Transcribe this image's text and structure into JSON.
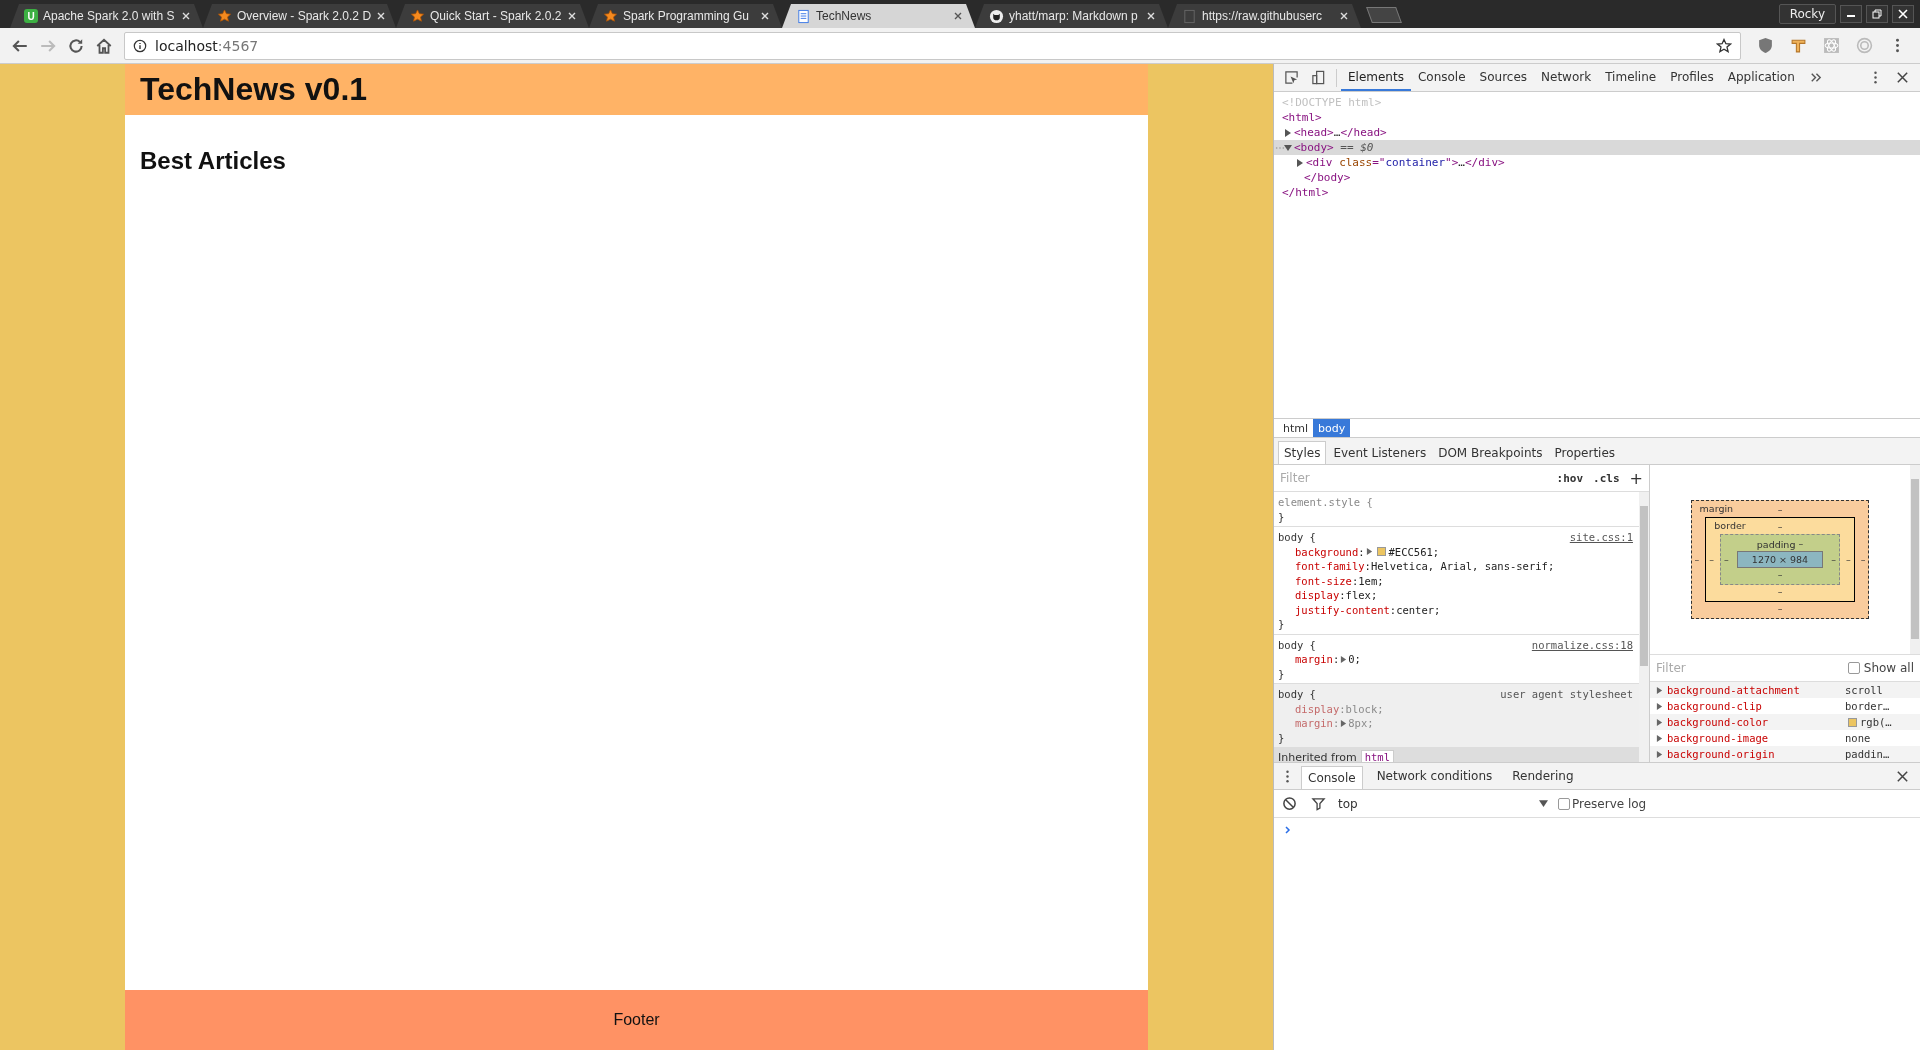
{
  "browser": {
    "tabs": [
      {
        "title": "Apache Spark 2.0 with S",
        "kind": "badge",
        "badge": "U",
        "selected": false
      },
      {
        "title": "Overview - Spark 2.0.2 D",
        "kind": "star",
        "selected": false
      },
      {
        "title": "Quick Start - Spark 2.0.2",
        "kind": "star",
        "selected": false
      },
      {
        "title": "Spark Programming Gu",
        "kind": "star",
        "selected": false
      },
      {
        "title": "TechNews",
        "kind": "doc",
        "selected": true
      },
      {
        "title": "yhatt/marp: Markdown p",
        "kind": "octo",
        "selected": false
      },
      {
        "title": "https://raw.githubuserc",
        "kind": "blank",
        "selected": false
      }
    ],
    "profile": "Rocky",
    "address": {
      "host": "localhost",
      "port": ":4567"
    }
  },
  "page": {
    "title": "TechNews v0.1",
    "heading": "Best Articles",
    "footer": "Footer"
  },
  "devtools": {
    "tabs": [
      {
        "label": "Elements",
        "selected": true
      },
      {
        "label": "Console",
        "selected": false
      },
      {
        "label": "Sources",
        "selected": false
      },
      {
        "label": "Network",
        "selected": false
      },
      {
        "label": "Timeline",
        "selected": false
      },
      {
        "label": "Profiles",
        "selected": false
      },
      {
        "label": "Application",
        "selected": false
      }
    ],
    "dom": [
      {
        "tokens": [
          {
            "text": "<!DOCTYPE html>",
            "kind": "doctype"
          }
        ]
      },
      {
        "tokens": [
          {
            "text": "<html>",
            "kind": "tag"
          }
        ],
        "closing": "</html>",
        "children": [
          {
            "tokens": [
              {
                "text": "<head>",
                "kind": "tag"
              },
              {
                "text": "…",
                "kind": "plain"
              },
              {
                "text": "</head>",
                "kind": "tag"
              }
            ],
            "expanded": false,
            "selected": false
          },
          {
            "tokens": [
              {
                "text": "<body>",
                "kind": "tag"
              },
              {
                "text": " == ",
                "kind": "marker"
              },
              {
                "text": "$0",
                "kind": "var"
              }
            ],
            "expanded": true,
            "selected": true,
            "closing": "</body>",
            "children": [
              {
                "tokens": [
                  {
                    "text": "<div ",
                    "kind": "tag"
                  },
                  {
                    "text": "class",
                    "kind": "attr"
                  },
                  {
                    "text": "=\"",
                    "kind": "tag"
                  },
                  {
                    "text": "container",
                    "kind": "value"
                  },
                  {
                    "text": "\">",
                    "kind": "tag"
                  },
                  {
                    "text": "…",
                    "kind": "plain"
                  },
                  {
                    "text": "</div>",
                    "kind": "tag"
                  }
                ],
                "expanded": false,
                "selected": false
              }
            ]
          }
        ]
      }
    ],
    "breadcrumbs": [
      {
        "label": "html",
        "selected": false
      },
      {
        "label": "body",
        "selected": true
      }
    ],
    "subtabs": [
      {
        "label": "Styles",
        "selected": true
      },
      {
        "label": "Event Listeners",
        "selected": false
      },
      {
        "label": "DOM Breakpoints",
        "selected": false
      },
      {
        "label": "Properties",
        "selected": false
      }
    ],
    "styles": {
      "filter": {
        "placeholder": "Filter"
      },
      "hov": ":hov",
      "cls": ".cls",
      "add": "+",
      "rules": [
        {
          "kind": "inline",
          "selector": "element.style {",
          "close": "}"
        },
        {
          "kind": "author",
          "selector": "body {",
          "source": "site.css:1",
          "close": "}",
          "declarations": [
            {
              "name": "background",
              "colon": ":",
              "expandable": true,
              "color": "#ecc561",
              "value": "#ECC561;",
              "overridden": false
            },
            {
              "name": "font-family",
              "colon": ":",
              "value": " Helvetica, Arial, sans-serif;",
              "overridden": false
            },
            {
              "name": "font-size",
              "colon": ":",
              "value": " 1em;",
              "overridden": false
            },
            {
              "name": "display",
              "colon": ":",
              "value": " flex;",
              "overridden": false
            },
            {
              "name": "justify-content",
              "colon": ":",
              "value": " center;",
              "overridden": false
            }
          ]
        },
        {
          "kind": "author",
          "selector": "body {",
          "source": "normalize.css:18",
          "close": "}",
          "declarations": [
            {
              "name": "margin",
              "colon": ":",
              "expandable": true,
              "value": "0;",
              "overridden": false
            }
          ]
        },
        {
          "kind": "ua",
          "selector": "body {",
          "source": "user agent stylesheet",
          "close": "}",
          "declarations": [
            {
              "name": "display",
              "colon": ":",
              "value": " block;",
              "overridden": true
            },
            {
              "name": "margin",
              "colon": ":",
              "expandable": true,
              "value": "8px;",
              "overridden": true
            }
          ]
        }
      ],
      "inherited": {
        "label": "Inherited from",
        "tag": "html"
      }
    },
    "box_model": {
      "margin": {
        "label": "margin",
        "top": "–",
        "right": "–",
        "bottom": "–",
        "left": "–"
      },
      "border": {
        "label": "border",
        "top": "–",
        "right": "–",
        "bottom": "–",
        "left": "–"
      },
      "padding": {
        "label": "padding",
        "top": "–",
        "right": "–",
        "bottom": "–",
        "left": "–"
      },
      "content": "1270 × 984"
    },
    "computed": {
      "filter": {
        "placeholder": "Filter"
      },
      "show_all": {
        "label": "Show all",
        "checked": false
      },
      "properties": [
        {
          "name": "background-attachment",
          "value": "scroll"
        },
        {
          "name": "background-clip",
          "value": "border…"
        },
        {
          "name": "background-color",
          "value": "rgb(…",
          "color": "#ecc561"
        },
        {
          "name": "background-image",
          "value": "none"
        },
        {
          "name": "background-origin",
          "value": "paddin…"
        }
      ]
    },
    "drawer": {
      "tabs": [
        {
          "label": "Console",
          "selected": true
        },
        {
          "label": "Network conditions",
          "selected": false
        },
        {
          "label": "Rendering",
          "selected": false
        }
      ],
      "context": "top",
      "preserve_log": {
        "label": "Preserve log",
        "checked": false
      }
    }
  }
}
